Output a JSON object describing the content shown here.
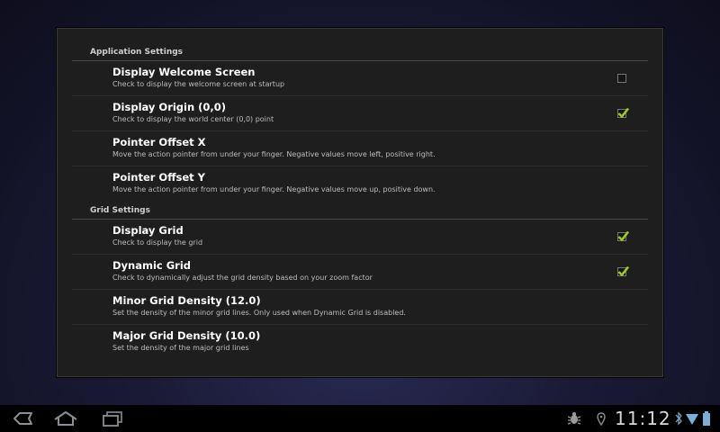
{
  "settings": {
    "sections": [
      {
        "title": "Application Settings",
        "items": [
          {
            "title": "Display Welcome Screen",
            "summary": "Check to display the welcome screen at startup",
            "has_checkbox": true,
            "checked": false
          },
          {
            "title": "Display Origin (0,0)",
            "summary": "Check to display the world center (0,0) point",
            "has_checkbox": true,
            "checked": true
          },
          {
            "title": "Pointer Offset X",
            "summary": "Move the action pointer from under your finger. Negative values move left, positive right.",
            "has_checkbox": false
          },
          {
            "title": "Pointer Offset Y",
            "summary": "Move the action pointer from under your finger. Negative values move up, positive down.",
            "has_checkbox": false
          }
        ]
      },
      {
        "title": "Grid Settings",
        "items": [
          {
            "title": "Display Grid",
            "summary": "Check to display the grid",
            "has_checkbox": true,
            "checked": true
          },
          {
            "title": "Dynamic Grid",
            "summary": "Check to dynamically adjust the grid density based on your zoom factor",
            "has_checkbox": true,
            "checked": true
          },
          {
            "title": "Minor Grid Density (12.0)",
            "summary": "Set the density of the minor grid lines. Only used when Dynamic Grid is disabled.",
            "has_checkbox": false
          },
          {
            "title": "Major Grid Density (10.0)",
            "summary": "Set the density of the major grid lines",
            "has_checkbox": false
          }
        ]
      }
    ]
  },
  "status_bar": {
    "time": "11:12",
    "icons": [
      "back-icon",
      "home-icon",
      "recent-apps-icon",
      "debug-icon",
      "location-icon",
      "bluetooth-icon",
      "wifi-icon",
      "battery-icon"
    ]
  },
  "colors": {
    "check_mark": "#9acd1a",
    "status_icon": "#7ab0d8",
    "nav_icon": "#8a8f95"
  }
}
